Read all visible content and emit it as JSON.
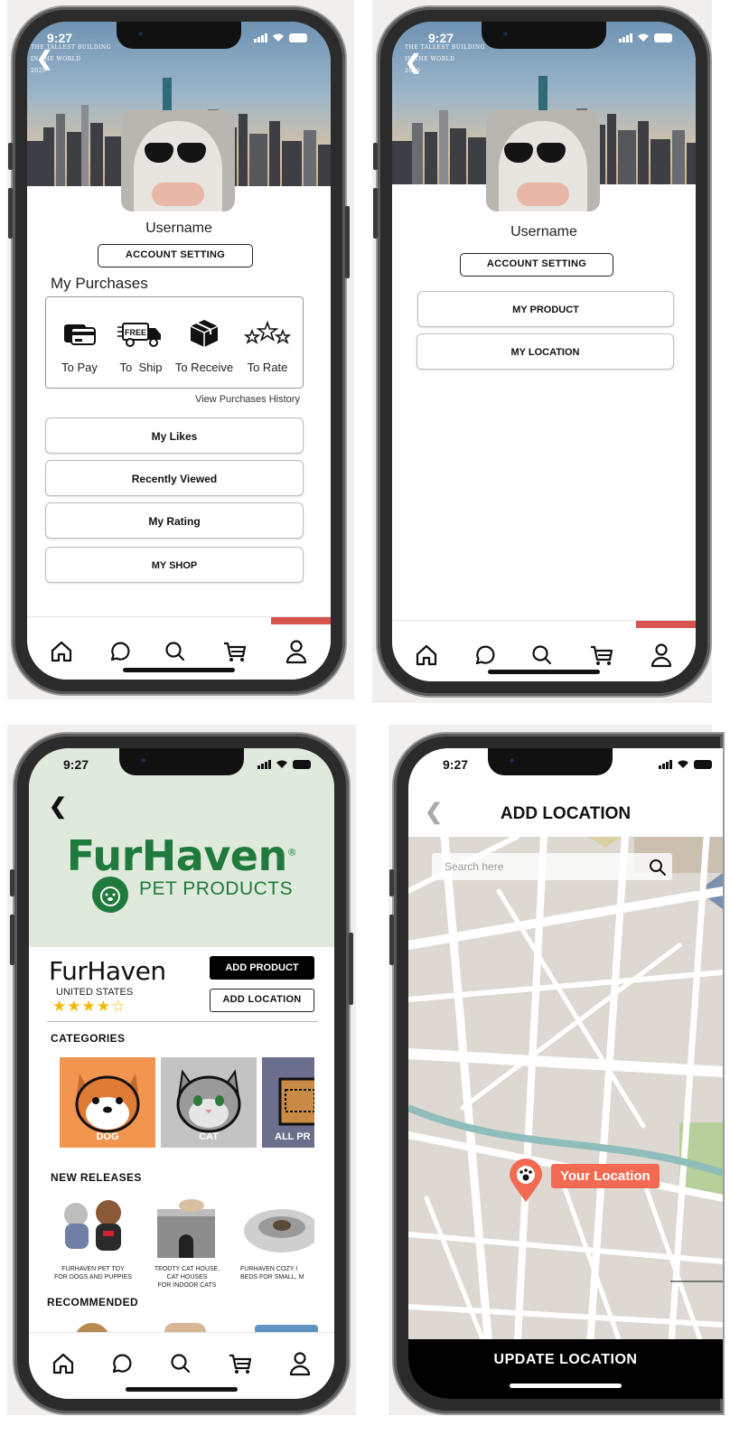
{
  "status": {
    "time": "9:27"
  },
  "colors": {
    "accent_red": "#d9534f",
    "brand_green": "#1f7a3c",
    "pin_orange": "#f26a52"
  },
  "profile_a": {
    "banner_text": [
      "THE TALLEST BUILDING",
      "IN THE WORLD",
      "2020"
    ],
    "username": "Username",
    "account_setting": "ACCOUNT SETTING",
    "my_purchases_title": "My Purchases",
    "purchases": [
      {
        "icon": "wallet-icon",
        "label": "To Pay"
      },
      {
        "icon": "free-shipping-truck-icon",
        "label": "To  Ship"
      },
      {
        "icon": "box-icon",
        "label": "To Receive"
      },
      {
        "icon": "stars-icon",
        "label": "To Rate"
      }
    ],
    "free_badge": "FREE",
    "view_history": "View Purchases History",
    "menu": [
      "My Likes",
      "Recently Viewed",
      "My Rating",
      "MY SHOP"
    ]
  },
  "profile_b": {
    "username": "Username",
    "account_setting": "ACCOUNT SETTING",
    "menu": [
      "MY PRODUCT",
      "MY LOCATION"
    ]
  },
  "tabbar": {
    "tabs": [
      "home-icon",
      "chat-icon",
      "search-icon",
      "cart-icon",
      "profile-icon"
    ],
    "active": "profile-icon"
  },
  "shop": {
    "logo_main": "FurHaven",
    "logo_reg": "®",
    "logo_sub": "PET PRODUCTS",
    "store_name": "FurHaven",
    "country": "UNITED STATES",
    "rating_stars": "★★★★☆",
    "add_product": "ADD PRODUCT",
    "add_location": "ADD LOCATION",
    "categories_title": "CATEGORIES",
    "categories": [
      "DOG",
      "CAT",
      "ALL PR"
    ],
    "new_releases_title": "NEW RELEASES",
    "new_releases": [
      {
        "line1": "FURHAVEN PET TOY",
        "line2": "FOR DOGS AND PUPPIES",
        "line3": ""
      },
      {
        "line1": "TEODTY CAT HOUSE,",
        "line2": "CAT HOUSES",
        "line3": "FOR INDOOR CATS"
      },
      {
        "line1": "FURHAVEN COZY I",
        "line2": "BEDS FOR SMALL, M",
        "line3": ""
      }
    ],
    "recommended_title": "RECOMMENDED"
  },
  "map_screen": {
    "title": "ADD LOCATION",
    "search_placeholder": "Search here",
    "pin_label": "Your Location",
    "update_button": "UPDATE LOCATION"
  }
}
